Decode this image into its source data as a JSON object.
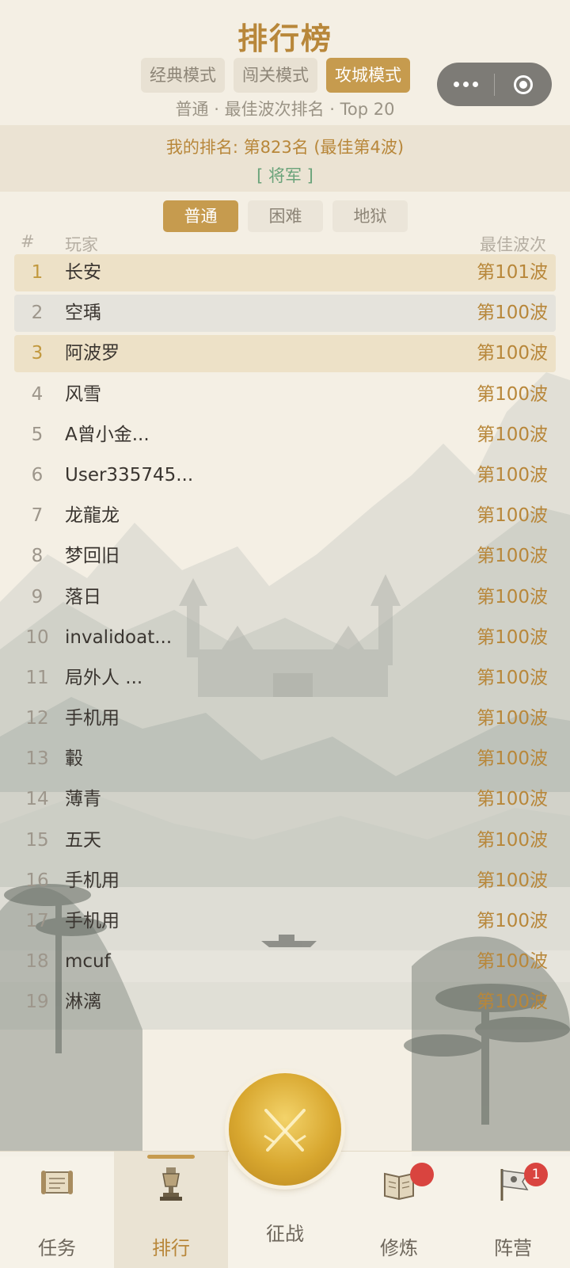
{
  "header": {
    "title": "排行榜",
    "modes": [
      "经典模式",
      "闯关模式",
      "攻城模式"
    ],
    "active_mode": "攻城模式",
    "subtitle": "普通 · 最佳波次排名 · Top 20"
  },
  "my_rank": {
    "text": "我的排名: 第823名 (最佳第4波)",
    "title": "[ 将军 ]"
  },
  "difficulty": {
    "tabs": [
      "普通",
      "困难",
      "地狱"
    ],
    "active": "普通"
  },
  "list": {
    "col_rank": "#",
    "col_player": "玩家",
    "col_wave": "最佳波次",
    "rows": [
      {
        "rank": "1",
        "player": "长安",
        "wave": "第101波"
      },
      {
        "rank": "2",
        "player": "空瑀",
        "wave": "第100波"
      },
      {
        "rank": "3",
        "player": "阿波罗",
        "wave": "第100波"
      },
      {
        "rank": "4",
        "player": "风雪",
        "wave": "第100波"
      },
      {
        "rank": "5",
        "player": "A曾小金...",
        "wave": "第100波"
      },
      {
        "rank": "6",
        "player": "User335745...",
        "wave": "第100波"
      },
      {
        "rank": "7",
        "player": "龙龍龙",
        "wave": "第100波"
      },
      {
        "rank": "8",
        "player": "梦回旧",
        "wave": "第100波"
      },
      {
        "rank": "9",
        "player": "落日",
        "wave": "第100波"
      },
      {
        "rank": "10",
        "player": "invalidoat...",
        "wave": "第100波"
      },
      {
        "rank": "11",
        "player": "局外人 ...",
        "wave": "第100波"
      },
      {
        "rank": "12",
        "player": "手机用",
        "wave": "第100波"
      },
      {
        "rank": "13",
        "player": "轂",
        "wave": "第100波"
      },
      {
        "rank": "14",
        "player": "薄青",
        "wave": "第100波"
      },
      {
        "rank": "15",
        "player": "五天",
        "wave": "第100波"
      },
      {
        "rank": "16",
        "player": "手机用",
        "wave": "第100波"
      },
      {
        "rank": "17",
        "player": "手机用",
        "wave": "第100波"
      },
      {
        "rank": "18",
        "player": "mcuf",
        "wave": "第100波"
      },
      {
        "rank": "19",
        "player": "淋漓",
        "wave": "第100波"
      }
    ]
  },
  "nav": {
    "items": [
      {
        "label": "任务",
        "icon": "scroll-icon"
      },
      {
        "label": "排行",
        "icon": "trophy-icon"
      },
      {
        "label": "征战",
        "icon": "crossed-swords-icon"
      },
      {
        "label": "修炼",
        "icon": "book-icon",
        "badge": ""
      },
      {
        "label": "阵营",
        "icon": "flag-icon",
        "badge": "1"
      }
    ],
    "active": "排行"
  },
  "colors": {
    "accent": "#c69b4e",
    "title": "#b8873a",
    "badge": "#d9443f",
    "rank_title": "#6aa37a"
  }
}
